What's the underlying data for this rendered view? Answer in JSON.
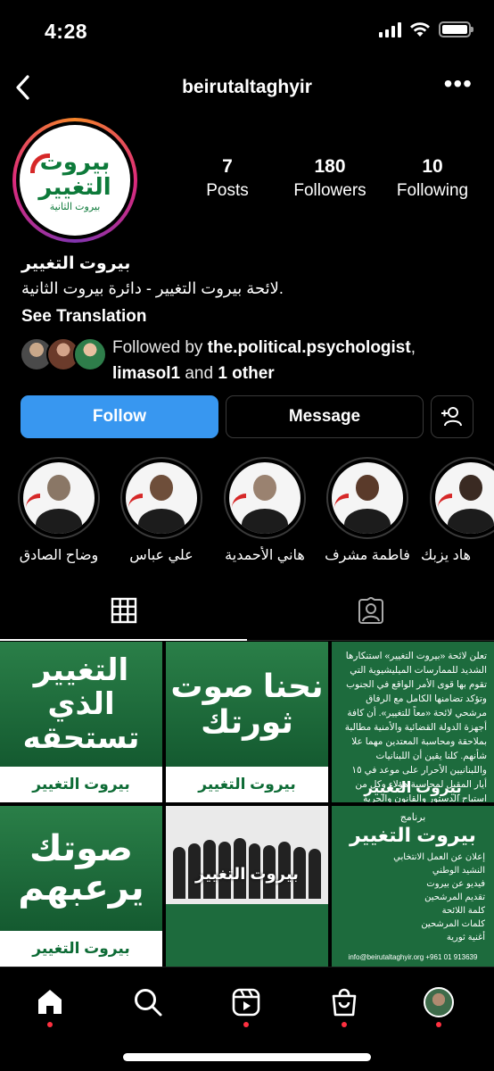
{
  "status": {
    "time": "4:28"
  },
  "header": {
    "username": "beirutaltaghyir"
  },
  "profile": {
    "avatar_lines": [
      "بيروت",
      "التغيير",
      "بيروت الثانية"
    ],
    "stats": [
      {
        "num": "7",
        "label": "Posts"
      },
      {
        "num": "180",
        "label": "Followers"
      },
      {
        "num": "10",
        "label": "Following"
      }
    ],
    "name": "بيروت التغيير",
    "bio": "لائحة بيروت التغيير - دائرة بيروت الثانية.",
    "see_translation": "See Translation",
    "followed_by": {
      "prefix": "Followed by ",
      "user1": "the.political.psychologist",
      "sep": ",",
      "user2": "limasol1",
      "mid": " and ",
      "other": "1 other"
    }
  },
  "actions": {
    "follow": "Follow",
    "message": "Message"
  },
  "highlights": [
    {
      "label": "وضاح الصادق"
    },
    {
      "label": "علي عباس"
    },
    {
      "label": "هاني الأحمدية"
    },
    {
      "label": "فاطمة مشرف"
    },
    {
      "label": "هاد يزبك"
    }
  ],
  "posts": {
    "p1": {
      "title": "التغيير الذي تستحقه",
      "footer": "بيروت التغيير"
    },
    "p2": {
      "title": "نحنا صوت ثورتك",
      "footer": "بيروت التغيير"
    },
    "p3": {
      "text": "تعلن لائحة «بيروت التغيير» استنكارها الشديد للممارسات الميليشيوية التي تقوم بها قوى الأمر الواقع في الجنوب وتؤكد تضامنها الكامل مع الرفاق مرشحي لائحة «معاً للتغيير». أن كافة أجهزة الدولة القضائية والأمنية مطالبة بملاحقة ومحاسبة المعتدين مهما علا شأنهم. كلنا يقين أن اللبنانيات واللبنانيين الأحرار على موعد في ١٥ أيار المقبل لمحاسبة هؤلاء وكل من استباح الدستور والقانون والحرية والديمقراطية في صناديق الاقتراع.",
      "footer": "بيروت التغيير"
    },
    "p4": {
      "title": "صوتك يرعبهم",
      "footer": "بيروت التغيير"
    },
    "p5": {
      "title": "بيروت التغيير"
    },
    "p6": {
      "badge": "برنامج",
      "title": "بيروت التغيير",
      "items": [
        "إعلان عن العمل الانتخابي",
        "النشيد الوطني",
        "فيديو عن بيروت",
        "تقديم المرشحين",
        "كلمة اللائحة",
        "كلمات المرشحين",
        "أغنية ثورية"
      ],
      "contact": "info@beirutaltaghyir.org  +961 01 913639"
    }
  },
  "colors": {
    "follow_blue": "#3897f0",
    "green": "#1d6b3d",
    "notify_red": "#ff3040"
  }
}
